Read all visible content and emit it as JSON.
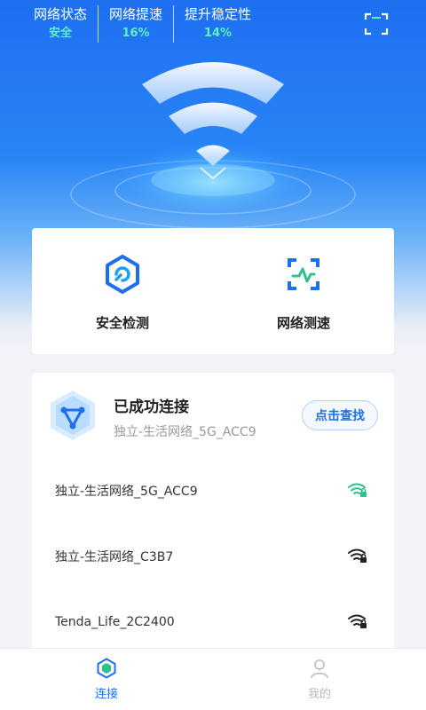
{
  "status": {
    "items": [
      {
        "label": "网络状态",
        "value": "安全"
      },
      {
        "label": "网络提速",
        "value": "16%"
      },
      {
        "label": "提升稳定性",
        "value": "14%"
      }
    ],
    "value_color": "#5ef0c2",
    "scan_icon": "scan-frame-icon"
  },
  "tools": [
    {
      "label": "安全检测",
      "icon": "security-check-icon"
    },
    {
      "label": "网络测速",
      "icon": "speed-test-icon"
    }
  ],
  "connection": {
    "title": "已成功连接",
    "ssid": "独立-生活网络_5G_ACC9",
    "find_button": "点击查找"
  },
  "wifi_list": [
    {
      "name": "独立-生活网络_5G_ACC9",
      "connected": true
    },
    {
      "name": "独立-生活网络_C3B7",
      "connected": false
    },
    {
      "name": "Tenda_Life_2C2400",
      "connected": false
    }
  ],
  "tabbar": {
    "tabs": [
      {
        "label": "连接",
        "active": true
      },
      {
        "label": "我的",
        "active": false
      }
    ],
    "active_color": "#1e6ff0",
    "inactive_color": "#bbbbbb"
  },
  "colors": {
    "primary": "#1e6ff0",
    "accent": "#2ec08f"
  }
}
